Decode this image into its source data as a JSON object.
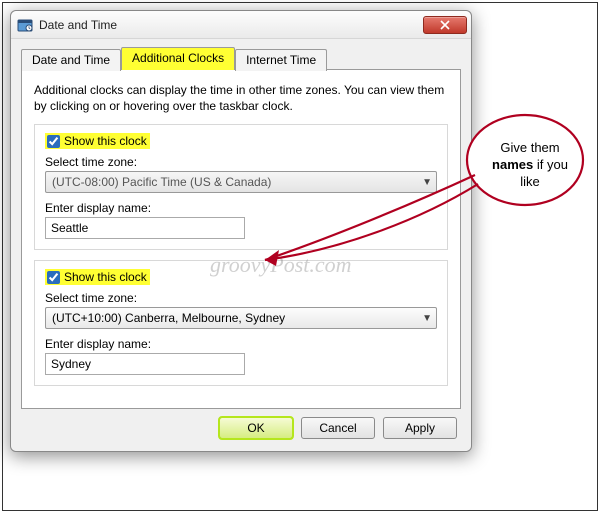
{
  "window": {
    "title": "Date and Time"
  },
  "tabs": {
    "dateTime": "Date and Time",
    "additionalClocks": "Additional Clocks",
    "internetTime": "Internet Time"
  },
  "panel": {
    "description": "Additional clocks can display the time in other time zones. You can view them by clicking on or hovering over the taskbar clock.",
    "showThisClockLabel": "Show this clock",
    "selectTimeZoneLabel": "Select time zone:",
    "enterDisplayNameLabel": "Enter display name:",
    "clock1": {
      "checked": true,
      "timezone": "(UTC-08:00) Pacific Time (US & Canada)",
      "displayName": "Seattle"
    },
    "clock2": {
      "checked": true,
      "timezone": "(UTC+10:00) Canberra, Melbourne, Sydney",
      "displayName": "Sydney"
    }
  },
  "buttons": {
    "ok": "OK",
    "cancel": "Cancel",
    "apply": "Apply"
  },
  "annotation": {
    "line1": "Give them",
    "bold": "names",
    "line2": " if you like"
  },
  "watermark": "groovyPost.com"
}
